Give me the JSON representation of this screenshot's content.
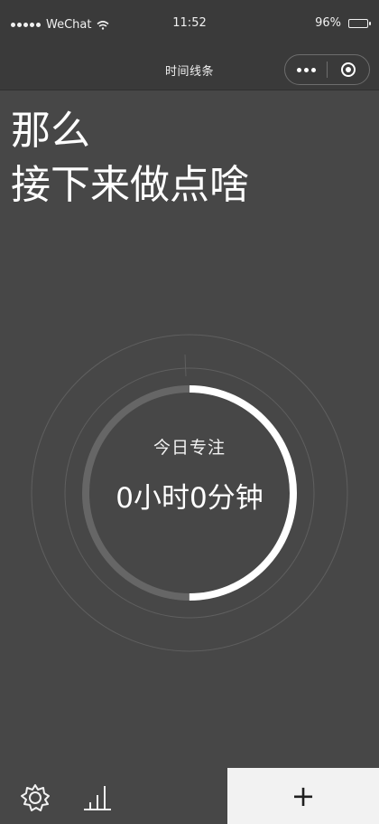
{
  "status_bar": {
    "carrier": "WeChat",
    "time": "11:52",
    "battery_percent": "96%",
    "battery_level": 0.96,
    "signal_dots": 5
  },
  "nav": {
    "title": "时间线条"
  },
  "heading": {
    "line1": "那么",
    "line2": "接下来做点啥"
  },
  "focus": {
    "label": "今日专注",
    "value": "0小时0分钟",
    "progress_fraction": 0.5,
    "colors": {
      "progress": "#ffffff",
      "track": "#666666",
      "guide_ring": "#5f5f5f"
    }
  },
  "bottom": {
    "add_label": "+"
  },
  "icons": {
    "wifi": "wifi-icon",
    "battery": "battery-icon",
    "more": "more-dots-icon",
    "close_target": "target-icon",
    "settings": "gear-icon",
    "stats": "bar-chart-icon",
    "add": "plus-icon"
  },
  "colors": {
    "background": "#474747",
    "header": "#3a3a3a",
    "text": "#ffffff",
    "add_button": "#f2f2f2"
  }
}
